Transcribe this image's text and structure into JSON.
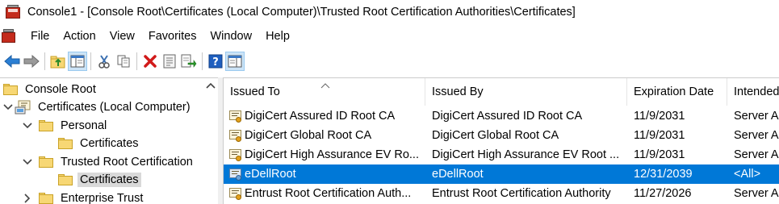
{
  "window": {
    "title": "Console1 - [Console Root\\Certificates (Local Computer)\\Trusted Root Certification Authorities\\Certificates]"
  },
  "menu": {
    "items": [
      "File",
      "Action",
      "View",
      "Favorites",
      "Window",
      "Help"
    ]
  },
  "toolbar": {
    "buttons": [
      "back-arrow-icon",
      "forward-arrow-icon",
      "up-folder-icon",
      "show-hide-tree-icon",
      "cut-icon",
      "copy-icon",
      "delete-icon",
      "properties-icon",
      "export-list-icon",
      "help-icon",
      "show-action-pane-icon"
    ]
  },
  "tree": {
    "items": [
      {
        "label": "Console Root",
        "level": 0,
        "expand": "none"
      },
      {
        "label": "Certificates (Local Computer)",
        "level": 0,
        "expand": "expanded"
      },
      {
        "label": "Personal",
        "level": 1,
        "expand": "expanded"
      },
      {
        "label": "Certificates",
        "level": 2,
        "expand": "none"
      },
      {
        "label": "Trusted Root Certification",
        "level": 1,
        "expand": "expanded"
      },
      {
        "label": "Certificates",
        "level": 2,
        "expand": "none",
        "selected": true
      },
      {
        "label": "Enterprise Trust",
        "level": 1,
        "expand": "collapsed"
      }
    ]
  },
  "list": {
    "columns": [
      "Issued To",
      "Issued By",
      "Expiration Date",
      "Intended Purposes"
    ],
    "rows": [
      {
        "issued_to": "DigiCert Assured ID Root CA",
        "issued_by": "DigiCert Assured ID Root CA",
        "expiration": "11/9/2031",
        "purpose": "Server Authentication"
      },
      {
        "issued_to": "DigiCert Global Root CA",
        "issued_by": "DigiCert Global Root CA",
        "expiration": "11/9/2031",
        "purpose": "Server Authentication"
      },
      {
        "issued_to": "DigiCert High Assurance EV Ro...",
        "issued_by": "DigiCert High Assurance EV Root ...",
        "expiration": "11/9/2031",
        "purpose": "Server Authentication"
      },
      {
        "issued_to": "eDellRoot",
        "issued_by": "eDellRoot",
        "expiration": "12/31/2039",
        "purpose": "<All>",
        "selected": true
      },
      {
        "issued_to": "Entrust Root Certification Auth...",
        "issued_by": "Entrust Root Certification Authority",
        "expiration": "11/27/2026",
        "purpose": "Server Authentication"
      }
    ]
  },
  "colors": {
    "selection": "#0078d7",
    "tree_selection": "#d9d9d9"
  }
}
